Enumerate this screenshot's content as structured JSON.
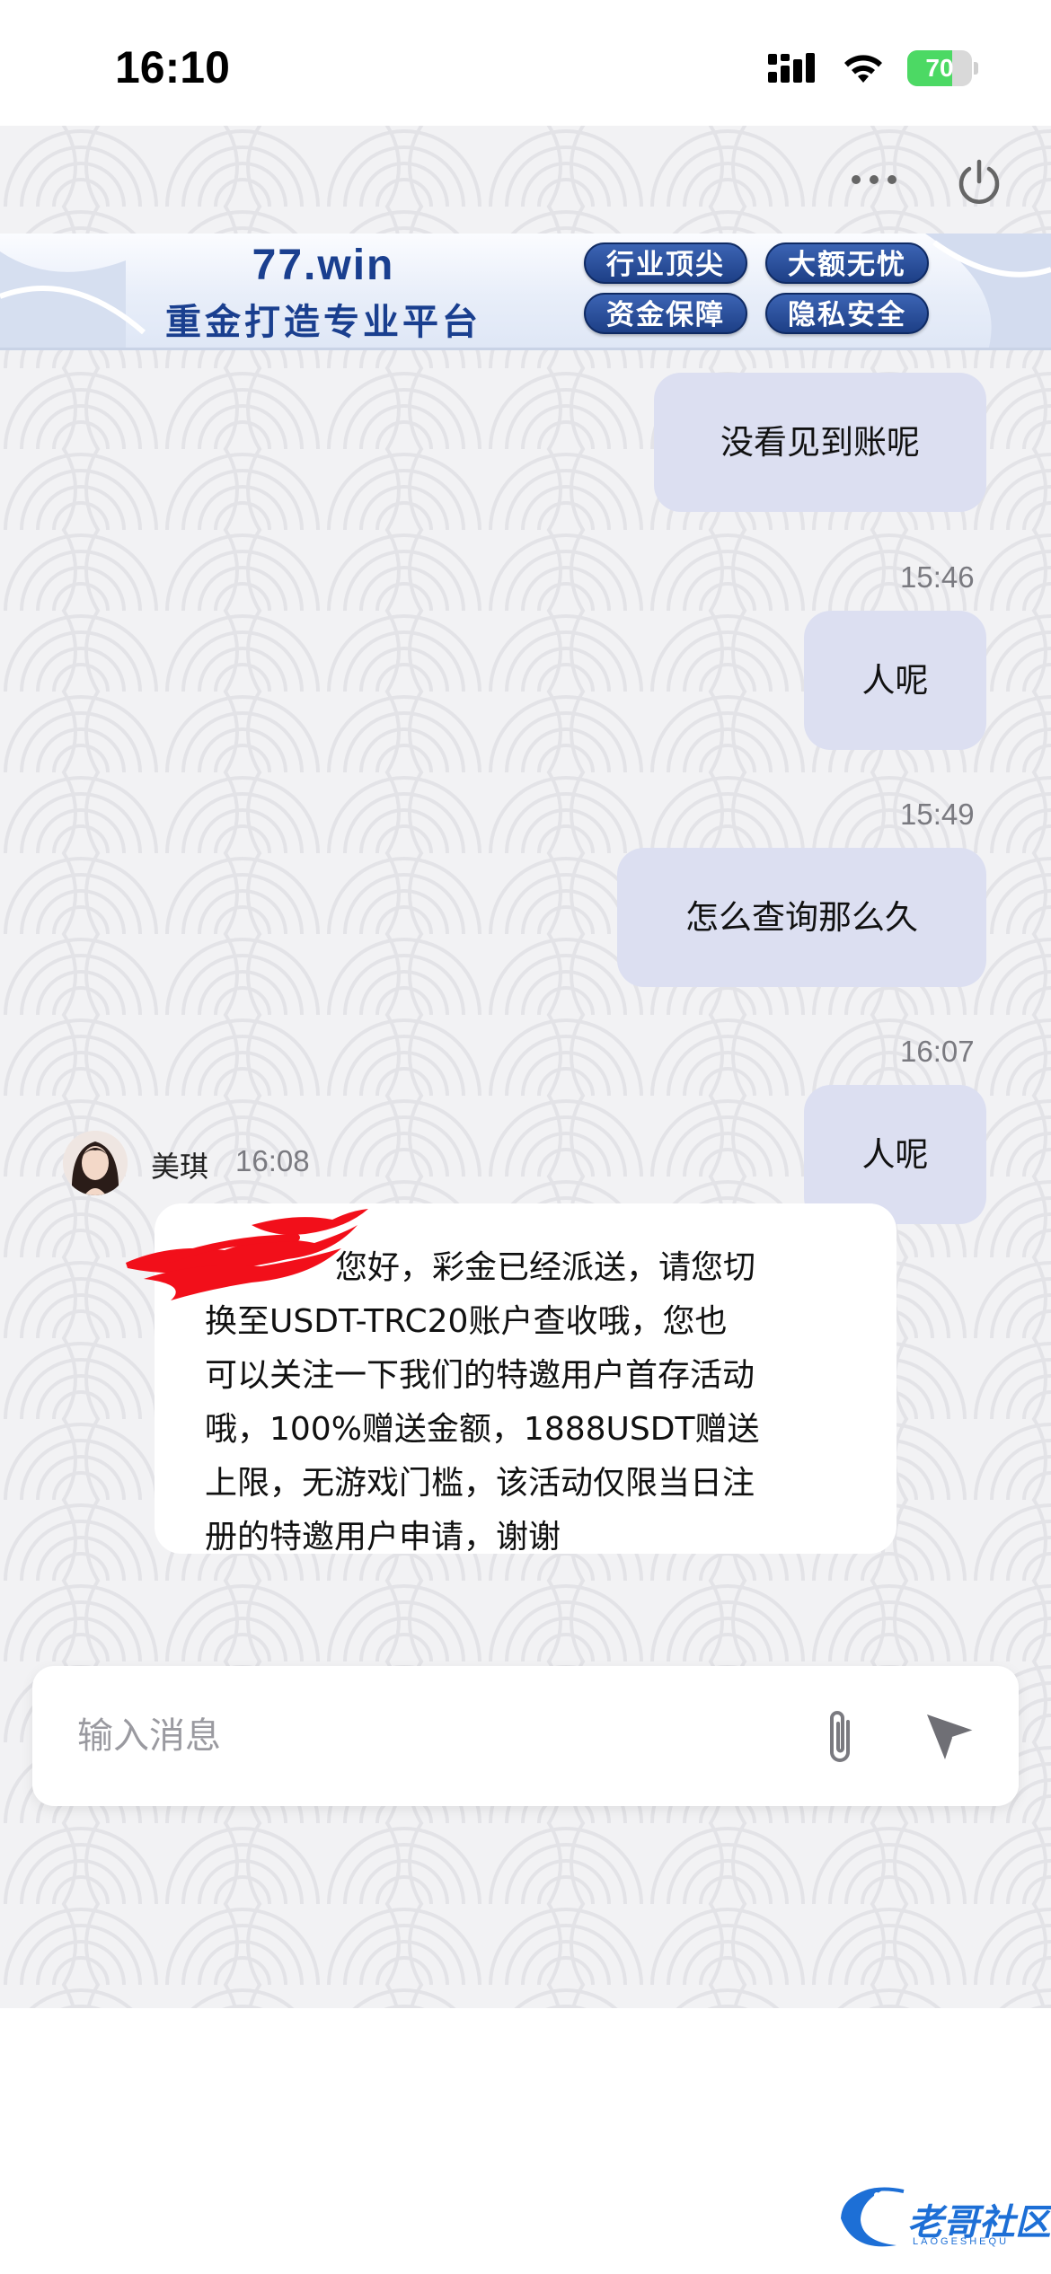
{
  "status_bar": {
    "time": "16:10",
    "battery": "70",
    "battery_level": 0.7,
    "icons": [
      "cellular-signal-icon",
      "wifi-icon",
      "battery-charging-icon"
    ]
  },
  "toolbar": {
    "icons": [
      "more-icon",
      "power-icon"
    ]
  },
  "banner": {
    "title": "77.win",
    "subtitle": "重金打造专业平台",
    "pills": [
      "行业顶尖",
      "大额无忧",
      "资金保障",
      "隐私安全"
    ]
  },
  "messages": {
    "out": [
      {
        "time": "",
        "text": "没看见到账呢"
      },
      {
        "time": "15:46",
        "text": "人呢"
      },
      {
        "time": "15:49",
        "text": "怎么查询那么久"
      },
      {
        "time": "16:07",
        "text": "人呢"
      }
    ],
    "in": {
      "name": "美琪",
      "time": "16:08",
      "lines": [
        "您好，彩金已经派送，请您切",
        "换至USDT-TRC20账户查收哦，您也",
        "可以关注一下我们的特邀用户首存活动",
        "哦，100%赠送金额，1888USDT赠送",
        "上限，无游戏门槛，该活动仅限当日注",
        "册的特邀用户申请，谢谢"
      ]
    }
  },
  "composer": {
    "placeholder": "输入消息",
    "value": ""
  },
  "watermark": {
    "text": "老哥社区",
    "sub": "LAOGESHEQU"
  },
  "colors": {
    "outgoing_bubble": "#dcdff1",
    "incoming_bubble": "#ffffff",
    "chat_background": "#f2f2f4",
    "banner_text": "#1a3f8f",
    "battery_green": "#4cd964"
  }
}
